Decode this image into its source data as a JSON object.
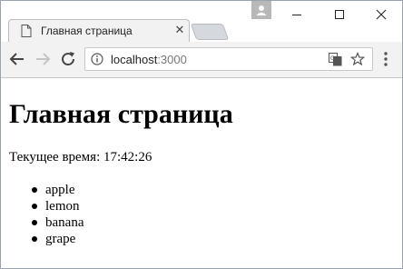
{
  "browser": {
    "tab": {
      "title": "Главная страница",
      "close_glyph": "✕",
      "icon": "document-icon"
    },
    "window_controls": {
      "minimize": "—",
      "maximize": "☐",
      "close": "✕"
    },
    "address_bar": {
      "host": "localhost",
      "port": ":3000"
    }
  },
  "page": {
    "heading": "Главная страница",
    "time_label": "Текущее время: 17:42:26",
    "items": [
      "apple",
      "lemon",
      "banana",
      "grape"
    ]
  },
  "colors": {
    "tab_bg": "#f2f2f2",
    "toolbar_bg": "#f2f2f2",
    "page_bg": "#ffffff"
  }
}
